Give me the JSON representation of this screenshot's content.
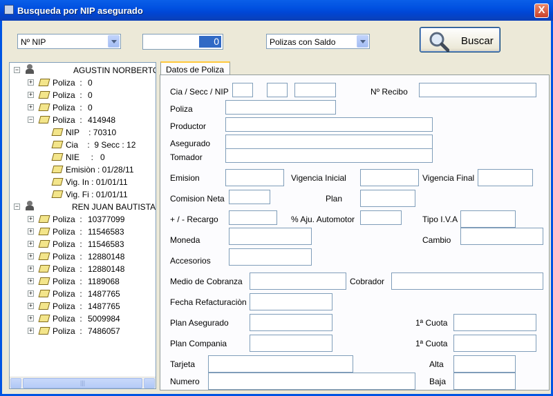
{
  "window": {
    "title": "Busqueda por NIP asegurado",
    "close": "X"
  },
  "toolbar": {
    "search_type": "Nº NIP",
    "number_value": "0",
    "filter": "Polizas con Saldo",
    "search_button": "Buscar"
  },
  "tree": {
    "person1": "AGUSTIN NORBERTO",
    "p1_polizas": [
      {
        "label": "Poliza  :",
        "value": "0"
      },
      {
        "label": "Poliza  :",
        "value": "0"
      },
      {
        "label": "Poliza  :",
        "value": "0"
      },
      {
        "label": "Poliza  :",
        "value": "414948"
      }
    ],
    "details": [
      "NIP    : 70310",
      "Cia    :  9 Secc : 12",
      "NIE     :   0",
      "Emisiòn : 01/28/11",
      "Vig. In : 01/01/11",
      "Vig. Fi : 01/01/11"
    ],
    "person2": "REN JUAN BAUTISTA",
    "p2_polizas": [
      {
        "label": "Poliza  :",
        "value": "10377099"
      },
      {
        "label": "Poliza  :",
        "value": "11546583"
      },
      {
        "label": "Poliza  :",
        "value": "11546583"
      },
      {
        "label": "Poliza  :",
        "value": "12880148"
      },
      {
        "label": "Poliza  :",
        "value": "12880148"
      },
      {
        "label": "Poliza  :",
        "value": "1189068"
      },
      {
        "label": "Poliza  :",
        "value": "1487765"
      },
      {
        "label": "Poliza  :",
        "value": "1487765"
      },
      {
        "label": "Poliza  :",
        "value": "5009984"
      },
      {
        "label": "Poliza  :",
        "value": "7486057"
      }
    ]
  },
  "form": {
    "tab": "Datos de Poliza",
    "labels": {
      "cia_secc_nip": "Cia / Secc / NIP",
      "recibo": "Nº Recibo",
      "poliza": "Poliza",
      "productor": "Productor",
      "asegurado": "Asegurado",
      "tomador": "Tomador",
      "emision": "Emision",
      "vig_inicial": "Vigencia Inicial",
      "vig_final": "Vigencia Final",
      "comision": "Comision Neta",
      "plan": "Plan",
      "recargo": "+ / - Recargo",
      "ajuste": "% Aju. Automotor",
      "iva": "Tipo I.V.A",
      "moneda": "Moneda",
      "cambio": "Cambio",
      "accesorios": "Accesorios",
      "medio_cobranza": "Medio de Cobranza",
      "cobrador": "Cobrador",
      "fecha_refact": "Fecha Refacturaciòn",
      "plan_asegurado": "Plan Asegurado",
      "cuota1": "1ª Cuota",
      "plan_compania": "Plan Compania",
      "cuota2": "1ª Cuota",
      "tarjeta": "Tarjeta",
      "alta": "Alta",
      "numero": "Numero",
      "baja": "Baja"
    }
  }
}
